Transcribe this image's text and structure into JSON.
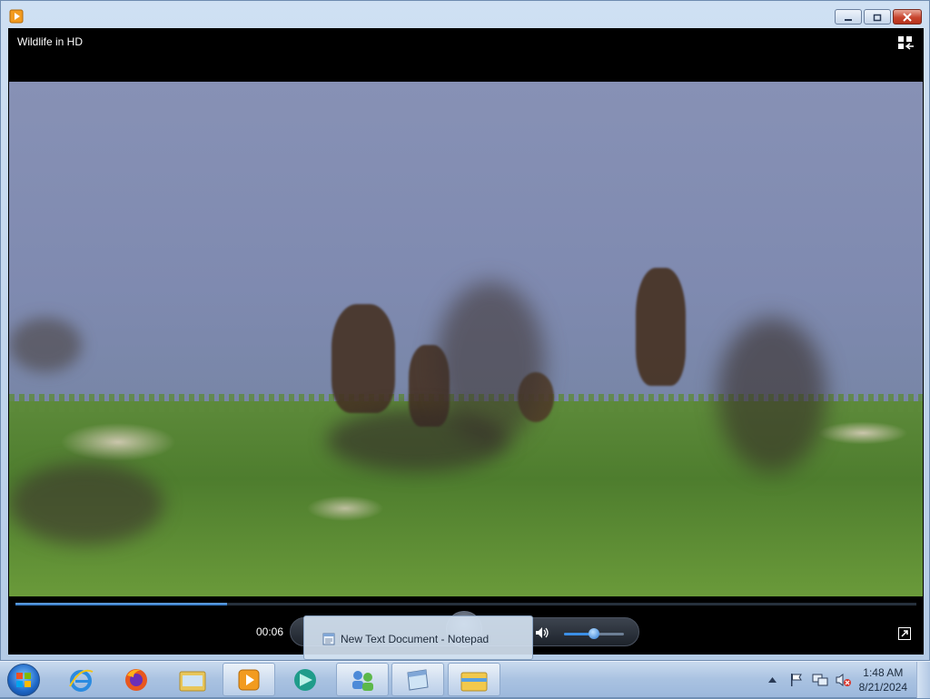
{
  "window": {
    "title_icon": "media-player-icon",
    "buttons": [
      "minimize",
      "maximize",
      "close"
    ]
  },
  "player": {
    "title": "Wildlife in HD",
    "current_time": "00:06",
    "seek_progress": 0.235,
    "volume_level": 0.5,
    "state": "playing"
  },
  "tooltip": {
    "text": "New Text Document - Notepad",
    "icon": "notepad-icon"
  },
  "taskbar": {
    "items": [
      {
        "name": "internet-explorer",
        "running": false
      },
      {
        "name": "firefox",
        "running": false
      },
      {
        "name": "file-manager",
        "running": false
      },
      {
        "name": "windows-media-player",
        "running": true
      },
      {
        "name": "app-teal",
        "running": false
      },
      {
        "name": "users-app",
        "running": true
      },
      {
        "name": "notepad",
        "running": true
      },
      {
        "name": "windows-explorer",
        "running": true
      }
    ],
    "clock": {
      "time": "1:48 AM",
      "date": "8/21/2024"
    }
  },
  "colors": {
    "accent": "#2d70c0",
    "player_bg": "#000000",
    "taskbar": "#a9c2e1"
  }
}
